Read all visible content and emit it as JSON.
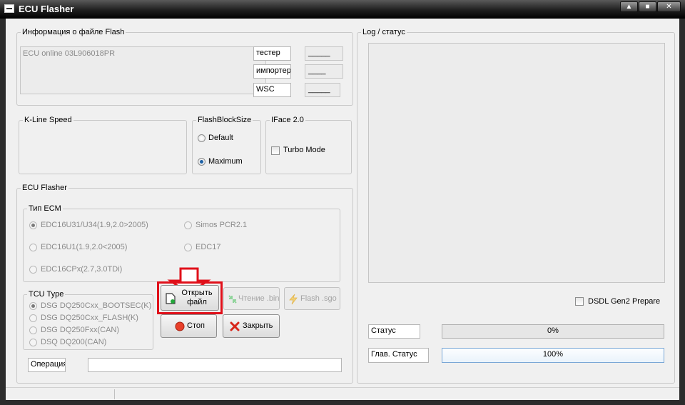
{
  "window": {
    "title": "ECU Flasher",
    "min_glyph": "▲",
    "max_glyph": "■",
    "close_glyph": "✕"
  },
  "file_info": {
    "legend": "Информация  о файле Flash",
    "ecu_text": "ECU online 03L906018PR",
    "fields": [
      {
        "label": "тестер",
        "value": "_____"
      },
      {
        "label": "импортер",
        "value": "____"
      },
      {
        "label": "WSC",
        "value": "_____"
      }
    ]
  },
  "kline": {
    "legend": "K-Line Speed"
  },
  "flashblock": {
    "legend": "FlashBlockSize",
    "options": [
      "Default",
      "Maximum"
    ],
    "selected": "Maximum"
  },
  "iface": {
    "legend": "IFace 2.0",
    "turbo_label": "Turbo Mode",
    "turbo_checked": false
  },
  "ecu_flasher": {
    "legend": "ECU Flasher",
    "ecm_type": {
      "legend": "Тип ECM",
      "options": [
        "EDC16U31/U34(1.9,2.0>2005)",
        "EDC16U1(1.9,2.0<2005)",
        "EDC16CPx(2.7,3.0TDi)",
        "Simos PCR2.1",
        "EDC17"
      ],
      "selected": "EDC16U31/U34(1.9,2.0>2005)"
    },
    "tcu_type": {
      "legend": "TCU Type",
      "options": [
        "DSG DQ250Cxx_BOOTSEC(K)",
        "DSG DQ250Cxx_FLASH(K)",
        "DSG DQ250Fxx(CAN)",
        "DSQ DQ200(CAN)"
      ],
      "selected": "DSG DQ250Cxx_BOOTSEC(K)"
    },
    "buttons": {
      "open_line1": "Открыть",
      "open_line2": "файл",
      "read": "Чтение .bin",
      "flash": "Flash .sgo",
      "stop": "Стоп",
      "close": "Закрыть"
    },
    "operation_label": "Операция",
    "operation_value": ""
  },
  "log": {
    "legend": "Log / статус",
    "dsdl_label": "DSDL Gen2 Prepare",
    "dsdl_checked": false,
    "status_label": "Статус",
    "status_value": "0%",
    "status_fraction": 0,
    "main_status_label": "Глав. Статус",
    "main_status_value": "100%",
    "main_status_fraction": 1
  },
  "colors": {
    "highlight": "#e0101a",
    "progress_fill": "#eaf3fb",
    "accent": "#1e62a6"
  }
}
